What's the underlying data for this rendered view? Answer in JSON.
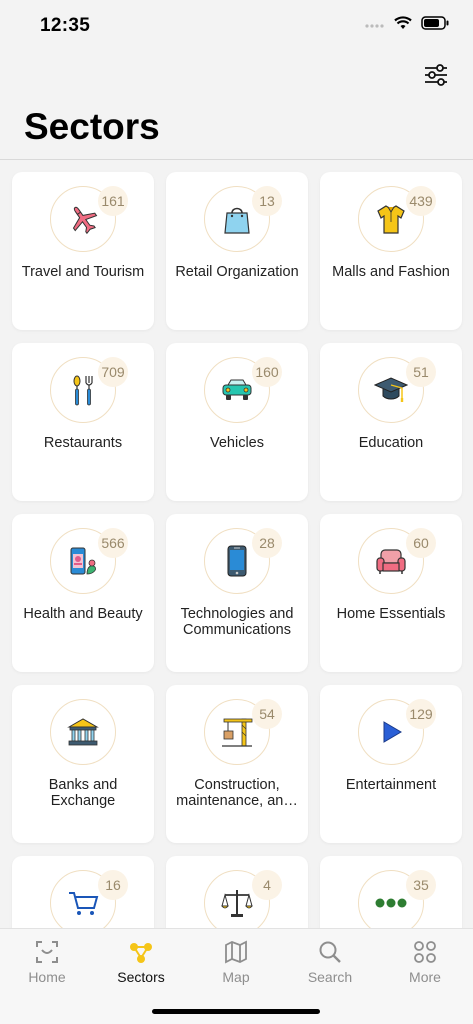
{
  "status_bar": {
    "time": "12:35"
  },
  "header": {
    "title": "Sectors",
    "filter_icon": "sliders-icon"
  },
  "sectors": [
    {
      "label": "Travel and Tourism",
      "count": "161",
      "icon": "airplane-icon"
    },
    {
      "label": "Retail Organization",
      "count": "13",
      "icon": "shopping-bag-icon"
    },
    {
      "label": "Malls and Fashion",
      "count": "439",
      "icon": "shirt-icon"
    },
    {
      "label": "Restaurants",
      "count": "709",
      "icon": "spoon-fork-icon"
    },
    {
      "label": "Vehicles",
      "count": "160",
      "icon": "car-icon"
    },
    {
      "label": "Education",
      "count": "51",
      "icon": "graduation-cap-icon"
    },
    {
      "label": "Health and Beauty",
      "count": "566",
      "icon": "cosmetics-icon"
    },
    {
      "label": "Technologies and Communications",
      "count": "28",
      "icon": "smartphone-icon"
    },
    {
      "label": "Home Essentials",
      "count": "60",
      "icon": "armchair-icon"
    },
    {
      "label": "Banks and Exchange",
      "count": "",
      "icon": "bank-icon"
    },
    {
      "label": "Construction, maintenance, an…",
      "count": "54",
      "icon": "crane-icon"
    },
    {
      "label": "Entertainment",
      "count": "129",
      "icon": "play-icon"
    },
    {
      "label": "",
      "count": "16",
      "icon": "cart-icon"
    },
    {
      "label": "",
      "count": "4",
      "icon": "scales-icon"
    },
    {
      "label": "",
      "count": "35",
      "icon": "more-dots-icon"
    }
  ],
  "tabs": [
    {
      "label": "Home",
      "icon": "home-frame-icon",
      "active": false
    },
    {
      "label": "Sectors",
      "icon": "sectors-icon",
      "active": true
    },
    {
      "label": "Map",
      "icon": "map-icon",
      "active": false
    },
    {
      "label": "Search",
      "icon": "search-icon",
      "active": false
    },
    {
      "label": "More",
      "icon": "grid-icon",
      "active": false
    }
  ],
  "colors": {
    "accent": "#f5c518",
    "badge_bg": "#fbf3e6",
    "badge_text": "#9a8a6c",
    "background": "#f3f3f3"
  }
}
